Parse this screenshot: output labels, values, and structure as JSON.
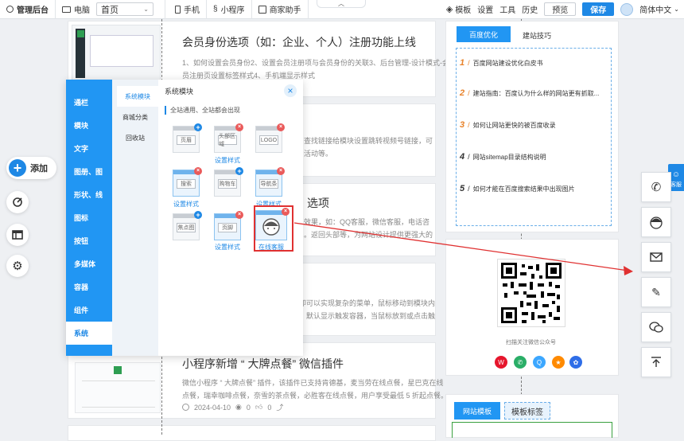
{
  "topbar": {
    "admin_label": "管理后台",
    "device_pc": "电脑",
    "page_select": "首页",
    "device_mobile": "手机",
    "mini_program": "小程序",
    "merchant_assistant": "商家助手",
    "template": "模板",
    "settings": "设置",
    "tools": "工具",
    "history": "历史",
    "preview": "预览",
    "save": "保存",
    "language": "简体中文"
  },
  "articles": [
    {
      "title": "会员身份选项（如：企业、个人）注册功能上线",
      "desc1": "1、如何设置会员身份2、设置会员注册项与会员身份的关联3、后台管理-设计模式-会",
      "desc2": "员注册页设置标签样式4、手机端显示样式"
    },
    {
      "partial1": "查找链接给模块设置跳转视频号链接，可",
      "partial2": "活动等。"
    },
    {
      "title_partial": "选项",
      "partial1": "效果，如：QQ客服，微信客服，电话咨",
      "partial2": "。返回头部等，为网站设计提供更强大的"
    },
    {
      "partial1": "即可以实现复杂的菜单，鼠标移动到模块内",
      "partial2": "，默认显示触发容器，当鼠标放到或点击触"
    },
    {
      "title": "小程序新增 “ 大牌点餐” 微信插件",
      "desc1": "微信小程序 “ 大牌点餐” 插件，该插件已支持肯德基，麦当劳在线点餐，星巴克在线",
      "desc2": "点餐，瑞幸咖啡点餐，奈雪的茶点餐，必胜客在线点餐，用户享受最低 5 折起点餐。",
      "date": "2024-04-10",
      "views": "0",
      "likes": "0"
    }
  ],
  "left_tools": {
    "add_label": "添加"
  },
  "module_panel": {
    "categories": [
      "通栏",
      "模块",
      "文字",
      "图册、图",
      "形状、线",
      "图标",
      "按钮",
      "多媒体",
      "容器",
      "组件",
      "系统"
    ],
    "active_category": "系统",
    "subcategories": [
      "系统模块",
      "商城分类",
      "回收站"
    ],
    "heading": "系统模块",
    "note": "全站通用、全站都会出现",
    "tiles": [
      {
        "label": "页眉",
        "caption": ""
      },
      {
        "label": "头部区域",
        "caption": "设置样式"
      },
      {
        "label": "LOGO",
        "caption": ""
      },
      {
        "label": "搜索",
        "caption": "设置样式"
      },
      {
        "label": "购物车",
        "caption": ""
      },
      {
        "label": "导航条",
        "caption": "设置样式"
      },
      {
        "label": "焦点图",
        "caption": ""
      },
      {
        "label": "页脚",
        "caption": "设置样式"
      },
      {
        "label": "",
        "caption": "在线客服"
      }
    ]
  },
  "right_column": {
    "tab_active": "百度优化",
    "tab_other": "建站技巧",
    "items": [
      {
        "num": "1",
        "text": "百度网站建设优化白皮书"
      },
      {
        "num": "2",
        "text": "建站指南：百度认为什么样的网站更有抓取..."
      },
      {
        "num": "3",
        "text": "如何让网站更快的被百度收录"
      },
      {
        "num": "4",
        "text": "网站sitemap目录结构说明"
      },
      {
        "num": "5",
        "text": "如何才能在百度搜索结果中出现图片"
      }
    ],
    "qr_caption": "扫描关注微信公众号",
    "bottom_tab_active": "网站模板",
    "bottom_tab_other": "模板标签"
  },
  "float_toolbar": {
    "side_tab": "客服"
  },
  "colors": {
    "accent": "#2196f3",
    "highlight": "#e03131",
    "hot_number": "#e8822a"
  }
}
